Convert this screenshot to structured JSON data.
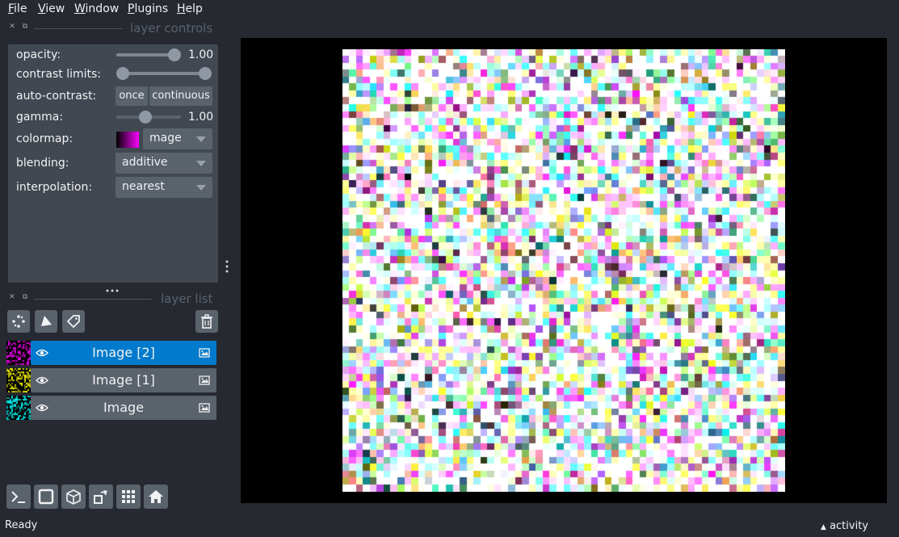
{
  "menu": {
    "items": [
      {
        "label_first": "F",
        "label_rest": "ile"
      },
      {
        "label_first": "V",
        "label_rest": "iew"
      },
      {
        "label_first": "W",
        "label_rest": "indow"
      },
      {
        "label_first": "P",
        "label_rest": "lugins"
      },
      {
        "label_first": "H",
        "label_rest": "elp"
      }
    ]
  },
  "layer_controls": {
    "title": "layer controls",
    "opacity_label": "opacity:",
    "opacity_value": "1.00",
    "opacity": 1.0,
    "contrast_label": "contrast limits:",
    "autocontrast_label": "auto-contrast:",
    "once_label": "once",
    "continuous_label": "continuous",
    "gamma_label": "gamma:",
    "gamma_value": "1.00",
    "colormap_label": "colormap:",
    "colormap_value": "mage",
    "blending_label": "blending:",
    "blending_value": "additive",
    "interpolation_label": "interpolation:",
    "interpolation_value": "nearest"
  },
  "layer_list": {
    "title": "layer list",
    "layers": [
      {
        "name": "Image [2]",
        "selected": true,
        "color": "#ff00ff"
      },
      {
        "name": "Image [1]",
        "selected": false,
        "color": "#ffff00"
      },
      {
        "name": "Image",
        "selected": false,
        "color": "#00ffff"
      }
    ]
  },
  "icons": {
    "points": "points-icon",
    "shapes": "shapes-icon",
    "labels": "labels-icon",
    "delete": "trash-icon",
    "console": "console-icon",
    "ndisplay": "square-icon",
    "roll": "cube-icon",
    "transpose": "transpose-icon",
    "grid": "grid-icon",
    "home": "home-icon"
  },
  "status": {
    "text": "Ready",
    "activity": "activity"
  },
  "colors": {
    "background": "#262930",
    "panel": "#414851",
    "button": "#5a626c",
    "selected": "#007acc"
  }
}
